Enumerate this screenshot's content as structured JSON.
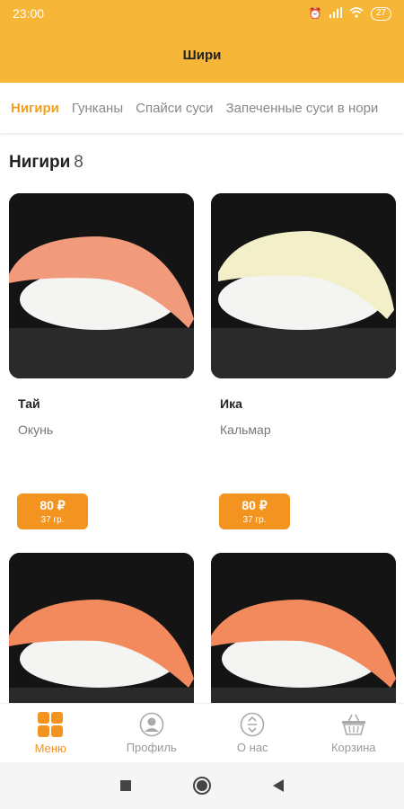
{
  "status": {
    "time": "23:00",
    "battery": "27"
  },
  "app": {
    "title": "Шири"
  },
  "tabs": [
    {
      "label": "Нигири",
      "active": true
    },
    {
      "label": "Гунканы",
      "active": false
    },
    {
      "label": "Спайси суси",
      "active": false
    },
    {
      "label": "Запеченные суси в нори",
      "active": false
    }
  ],
  "section": {
    "title": "Нигири",
    "count": "8"
  },
  "products": [
    {
      "name": "Тай",
      "desc": "Окунь",
      "price": "80 ₽",
      "weight": "37 гр.",
      "fish_color": "#f19a7c"
    },
    {
      "name": "Ика",
      "desc": "Кальмар",
      "price": "80 ₽",
      "weight": "37 гр.",
      "fish_color": "#f3efc9"
    },
    {
      "name": "",
      "desc": "",
      "price": "",
      "weight": "",
      "fish_color": "#f28a5e"
    },
    {
      "name": "",
      "desc": "",
      "price": "",
      "weight": "",
      "fish_color": "#f28a5e"
    }
  ],
  "bottom_nav": [
    {
      "label": "Меню",
      "icon": "grid-icon",
      "active": true
    },
    {
      "label": "Профиль",
      "icon": "profile-icon",
      "active": false
    },
    {
      "label": "О нас",
      "icon": "info-icon",
      "active": false
    },
    {
      "label": "Корзина",
      "icon": "basket-icon",
      "active": false
    }
  ],
  "colors": {
    "brand": "#f6b638",
    "accent": "#f39421"
  }
}
